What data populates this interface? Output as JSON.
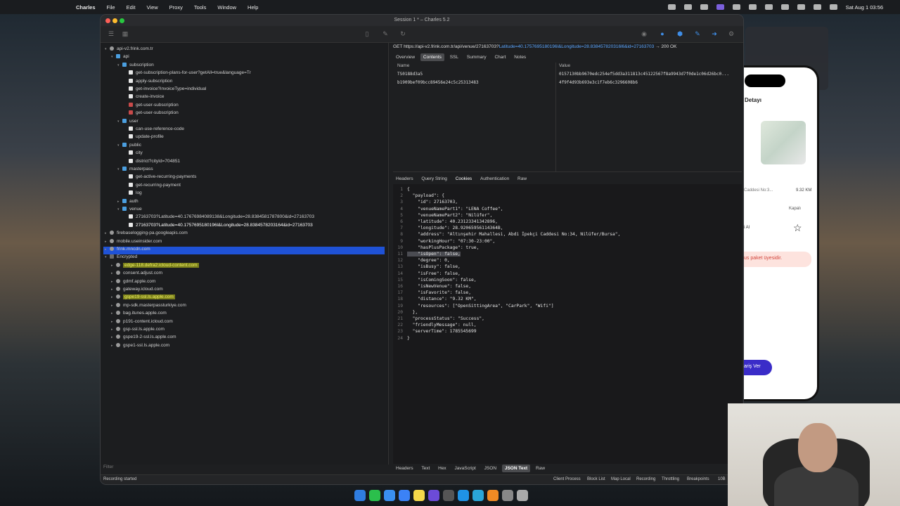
{
  "menubar": {
    "app": "Charles",
    "items": [
      "File",
      "Edit",
      "View",
      "Proxy",
      "Tools",
      "Window",
      "Help"
    ],
    "clock": "Sat Aug 1  03:56"
  },
  "window": {
    "title": "Session 1 * – Charles 5.2"
  },
  "tree": [
    {
      "label": "api-v2.frink.com.tr",
      "depth": 0,
      "icon": "globe",
      "chev": "▾"
    },
    {
      "label": "api",
      "depth": 1,
      "icon": "folder",
      "chev": "▾"
    },
    {
      "label": "subscription",
      "depth": 2,
      "icon": "folder",
      "chev": "▾"
    },
    {
      "label": "get-subscription-plans-for-user?getAll=true&language=Tr",
      "depth": 3,
      "icon": "file"
    },
    {
      "label": "apply-subscription",
      "depth": 3,
      "icon": "file"
    },
    {
      "label": "get-invoice?invoiceType=individual",
      "depth": 3,
      "icon": "file"
    },
    {
      "label": "create-invoice",
      "depth": 3,
      "icon": "file"
    },
    {
      "label": "get-user-subscription",
      "depth": 3,
      "icon": "red"
    },
    {
      "label": "get-user-subscription",
      "depth": 3,
      "icon": "red"
    },
    {
      "label": "user",
      "depth": 2,
      "icon": "folder",
      "chev": "▾"
    },
    {
      "label": "can-use-reference-code",
      "depth": 3,
      "icon": "file"
    },
    {
      "label": "update-profile",
      "depth": 3,
      "icon": "file"
    },
    {
      "label": "public",
      "depth": 2,
      "icon": "folder",
      "chev": "▾"
    },
    {
      "label": "city",
      "depth": 3,
      "icon": "file"
    },
    {
      "label": "district?cityId=704851",
      "depth": 3,
      "icon": "file"
    },
    {
      "label": "masterpass",
      "depth": 2,
      "icon": "folder",
      "chev": "▾"
    },
    {
      "label": "get-active-recurring-payments",
      "depth": 3,
      "icon": "file"
    },
    {
      "label": "get-recurring-payment",
      "depth": 3,
      "icon": "file"
    },
    {
      "label": "log",
      "depth": 3,
      "icon": "file"
    },
    {
      "label": "auth",
      "depth": 2,
      "icon": "folder",
      "chev": "▸"
    },
    {
      "label": "venue",
      "depth": 2,
      "icon": "folder",
      "chev": "▾"
    },
    {
      "label": "27163703?Latitude=40.17676984089138&Longitude=28.8384581787800&id=27163703",
      "depth": 3,
      "icon": "file"
    },
    {
      "label": "27163703?Latitude=40.1757695180196l&Longitude=28.8384578203164&id=27163703",
      "depth": 3,
      "icon": "file",
      "selected": true
    },
    {
      "label": "firebaselogging-pa.googleapis.com",
      "depth": 0,
      "icon": "globe",
      "chev": "▸"
    },
    {
      "label": "mobile.useinsider.com",
      "depth": 0,
      "icon": "globe",
      "chev": "▸"
    },
    {
      "label": "frink.mncdn.com",
      "depth": 0,
      "icon": "globe",
      "chev": "▸"
    },
    {
      "label": "Encrypted",
      "depth": 0,
      "icon": "lock",
      "chev": "▾"
    },
    {
      "label": "edge-118.defra2.icloud-content.com",
      "depth": 1,
      "icon": "globe",
      "chev": "▸",
      "hl": true
    },
    {
      "label": "consent.adjust.com",
      "depth": 1,
      "icon": "globe",
      "chev": "▸"
    },
    {
      "label": "gdmf.apple.com",
      "depth": 1,
      "icon": "globe",
      "chev": "▸"
    },
    {
      "label": "gateway.icloud.com",
      "depth": 1,
      "icon": "globe",
      "chev": "▸"
    },
    {
      "label": "gspe19-ssl.ls.apple.com",
      "depth": 1,
      "icon": "globe",
      "chev": "▸",
      "hl": true
    },
    {
      "label": "mp-sdk.masterpassturkiye.com",
      "depth": 1,
      "icon": "globe",
      "chev": "▸"
    },
    {
      "label": "bag.itunes.apple.com",
      "depth": 1,
      "icon": "globe",
      "chev": "▸"
    },
    {
      "label": "p191-content.icloud.com",
      "depth": 1,
      "icon": "globe",
      "chev": "▸"
    },
    {
      "label": "gsp-ssl.ls.apple.com",
      "depth": 1,
      "icon": "globe",
      "chev": "▸"
    },
    {
      "label": "gspe19-2-ssl.ls.apple.com",
      "depth": 1,
      "icon": "globe",
      "chev": "▸"
    },
    {
      "label": "gspe1-ssl.ls.apple.com",
      "depth": 1,
      "icon": "globe",
      "chev": "▸"
    }
  ],
  "filter_label": "Filter",
  "status": {
    "text": "Recording started",
    "buttons": [
      "Client Process",
      "Block List",
      "Map Local",
      "Recording",
      "Throttling",
      "Breakpoints",
      "10B"
    ]
  },
  "request": {
    "method": "GET",
    "url": "https://api-v2.frink.com.tr/api/venue/27163703?",
    "query": "Latitude=40.1757695180196l&Longitude=28.838457820316l6&id=27163703",
    "result": "→ 200 OK"
  },
  "tabs_top": [
    "Overview",
    "Contents",
    "SSL",
    "Summary",
    "Chart",
    "Notes"
  ],
  "cookies_table": {
    "headers": [
      "Name",
      "Value"
    ],
    "rows": [
      [
        "TS0188d3a5",
        "0157130bb9670edc254ef5dd3a311813c45122567f8a9943d7f0de1c06d26bc0..."
      ],
      [
        "b1909bef09bcc89456e24c5c25313483",
        "4f9f4d93b693e3c1f7eb6c3296608b6"
      ]
    ]
  },
  "tabs_mid": [
    "Headers",
    "Query String",
    "Cookies",
    "Authentication",
    "Raw"
  ],
  "tabs_bottom": [
    "Headers",
    "Text",
    "Hex",
    "JavaScript",
    "JSON",
    "JSON Text",
    "Raw"
  ],
  "code_lines": [
    "{",
    "  \"payload\": {",
    "    \"id\": 27163703,",
    "    \"venueNamePart1\": \"LENA Coffee\",",
    "    \"venueNamePart2\": \"Nilüfer\",",
    "    \"latitude\": 40.23123341342896,",
    "    \"longitude\": 28.92065956114364B,",
    "    \"address\": \"Altınşehir Mahallesi, Abdi İpekçi Caddesi No:34, Nilüfer/Bursa\",",
    "    \"workingHour\": \"07:30-23:00\",",
    "    \"hasPlusPackage\": true,",
    "    \"isOpen\": false,",
    "    \"degree\": 0,",
    "    \"isBusy\": false,",
    "    \"isFree\": false,",
    "    \"isComingSoon\": false,",
    "    \"isNewVenue\": false,",
    "    \"isFavorite\": false,",
    "    \"distance\": \"9.32 KM\",",
    "    \"resources\": [\"OpenSittingArea\", \"CarPark\", \"Wifi\"]",
    "  },",
    "  \"processStatus\": \"Success\",",
    "  \"friendlyMessage\": null,",
    "  \"serverTime\": 1785545699",
    "}"
  ],
  "phone": {
    "title": "Detayı",
    "address": "Caddesi No:3...",
    "distance": "9.32 KM",
    "status": "Kapalı",
    "ai": "i AI",
    "banner": "us paket üyesidir.",
    "button": "ariş Ver"
  }
}
